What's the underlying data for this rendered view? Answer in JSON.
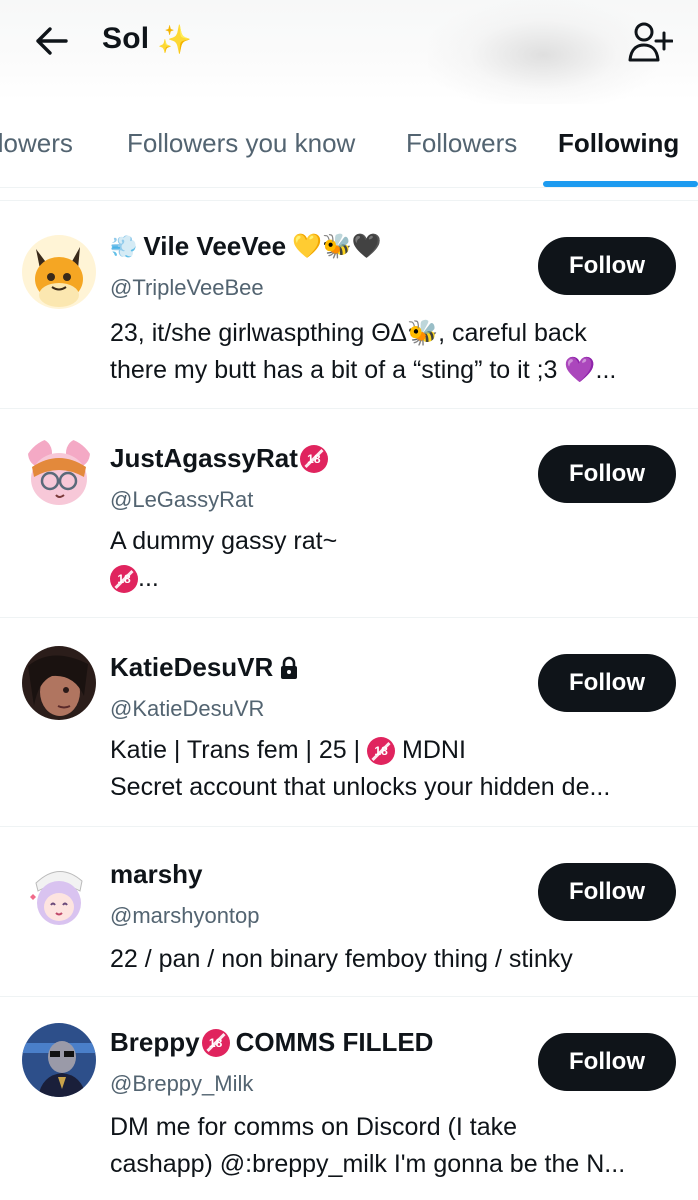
{
  "header": {
    "title": "Sol",
    "title_sparkle": "✨"
  },
  "tabs": [
    {
      "label": "llowers"
    },
    {
      "label": "Followers you know"
    },
    {
      "label": "Followers"
    },
    {
      "label": "Following",
      "active": true
    }
  ],
  "accent_color": "#1d9bf0",
  "follow_button_label": "Follow",
  "users": [
    {
      "name": "Vile VeeVee",
      "name_prefix_emoji": "💨",
      "name_suffix_emoji": [
        "💛",
        "🐝",
        "🖤"
      ],
      "handle": "@TripleVeeBee",
      "bio_lines": [
        "23, it/she girlwaspthing ΘΔ🐝, careful back",
        "there my butt has a bit of a “sting” to it ;3 💜..."
      ]
    },
    {
      "name": "JustAgassyRat",
      "name_badge": "18",
      "handle": "@LeGassyRat",
      "bio_lines": [
        "A dummy gassy rat~",
        "..."
      ]
    },
    {
      "name": "KatieDesuVR",
      "name_icon": "lock-icon",
      "handle": "@KatieDesuVR",
      "bio_lines": [
        "Katie | Trans fem | 25 | ",
        " MDNI",
        "Secret account that unlocks your hidden de..."
      ]
    },
    {
      "name": "marshy",
      "handle": "@marshyontop",
      "bio_lines": [
        "22 / pan / non binary femboy thing / stinky"
      ]
    },
    {
      "name": "Breppy",
      "name_badge": "18",
      "name_suffix": "COMMS FILLED",
      "handle": "@Breppy_Milk",
      "bio_lines": [
        "DM me for comms on Discord (I take",
        "cashapp) @:breppy_milk I'm gonna be the N..."
      ]
    }
  ]
}
